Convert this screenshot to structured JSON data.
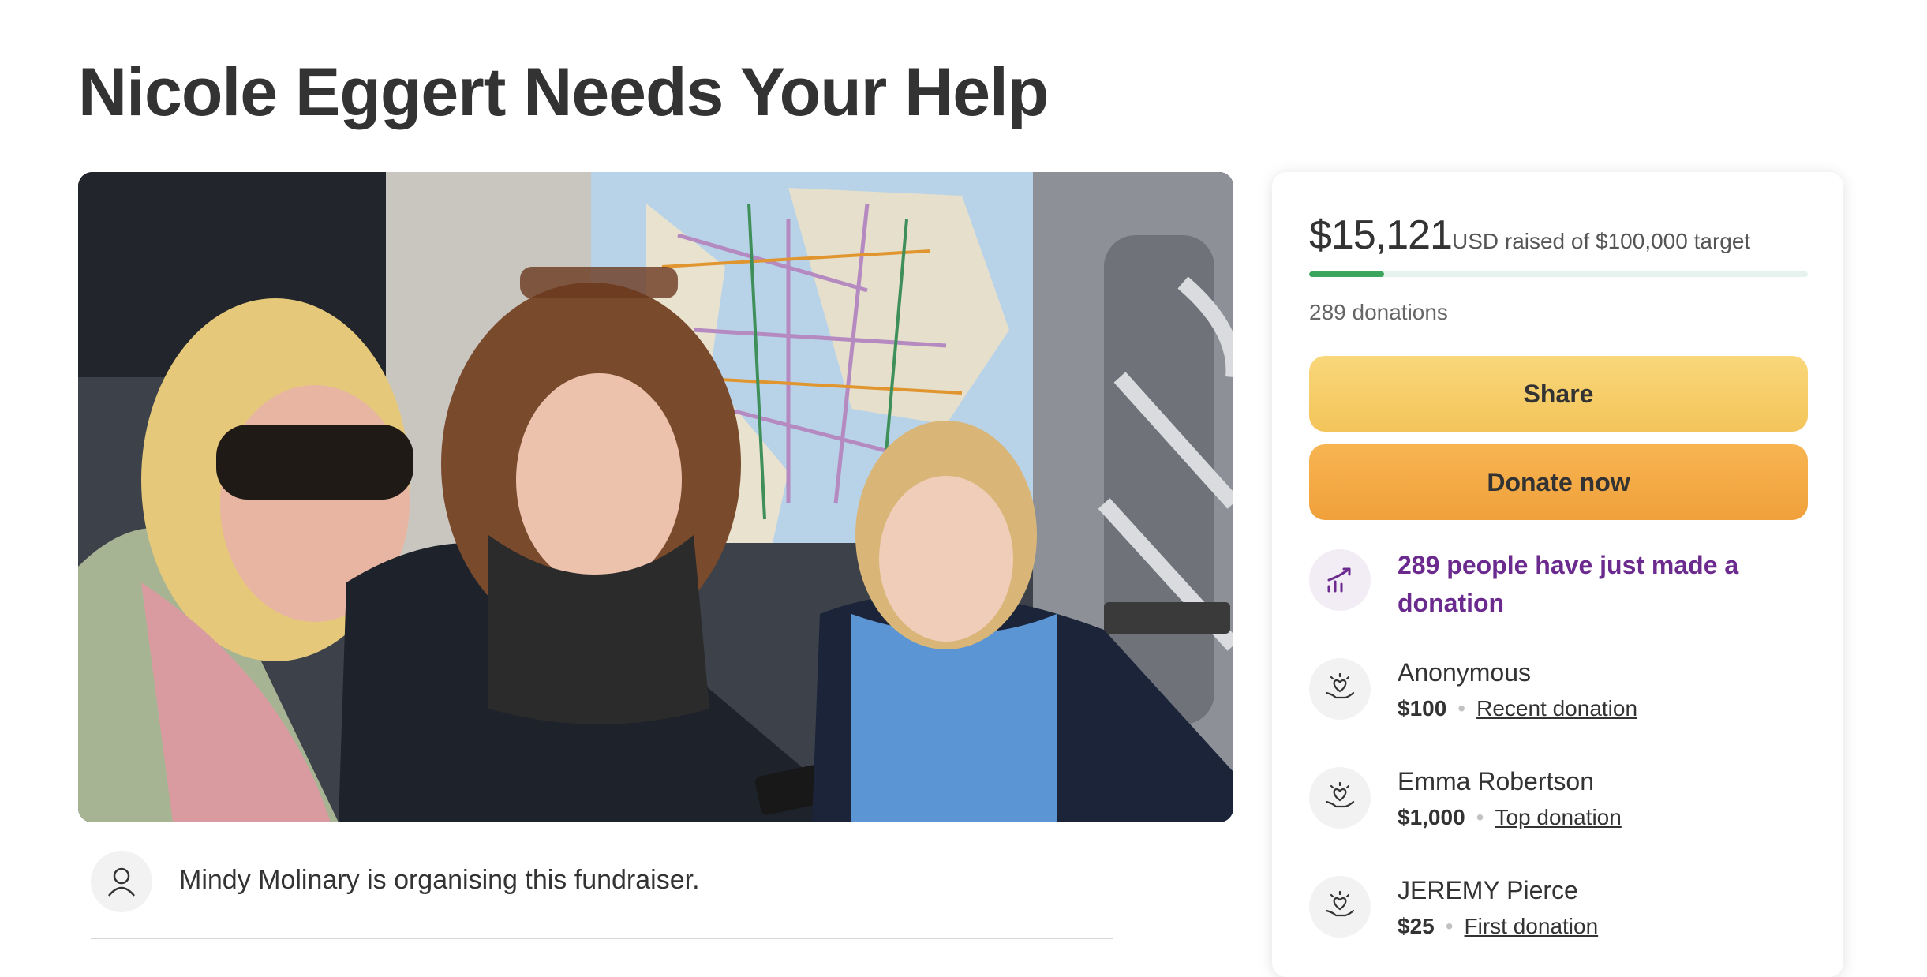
{
  "page": {
    "title": "Nicole Eggert Needs Your Help"
  },
  "organiser": {
    "text": "Mindy Molinary is organising this fundraiser."
  },
  "progress": {
    "amount": "$15,121",
    "currency_and_target": "USD raised of $100,000 target",
    "fraction": 0.151,
    "donations": "289 donations"
  },
  "buttons": {
    "share": "Share",
    "donate": "Donate now"
  },
  "trending": {
    "text": "289 people have just made a donation"
  },
  "donors": [
    {
      "name": "Anonymous",
      "amount": "$100",
      "tag": "Recent donation"
    },
    {
      "name": "Emma Robertson",
      "amount": "$1,000",
      "tag": "Top donation"
    },
    {
      "name": "JEREMY Pierce",
      "amount": "$25",
      "tag": "First donation"
    }
  ],
  "colors": {
    "progress": "#3aa55c",
    "trend_text": "#6b2a8e",
    "share": "#f6cf6c",
    "donate": "#f3a948"
  },
  "icons": [
    "user-icon",
    "trending-up-icon",
    "heart-hand-icon"
  ]
}
